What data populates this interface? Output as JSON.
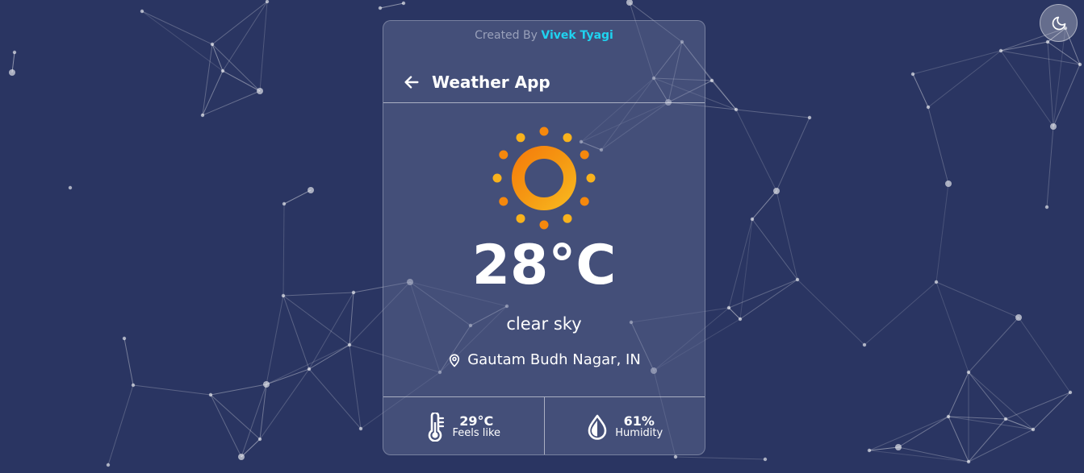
{
  "credit": {
    "prefix": "Created By",
    "author": "Vivek Tyagi"
  },
  "header": {
    "title": "Weather App"
  },
  "weather": {
    "temperature": "28°C",
    "description": "clear sky",
    "location": "Gautam Budh Nagar, IN"
  },
  "stats": {
    "feels_like": {
      "value": "29°C",
      "label": "Feels like"
    },
    "humidity": {
      "value": "61%",
      "label": "Humidity"
    }
  },
  "colors": {
    "background": "#2a3562",
    "accent": "#1fd3f0",
    "sun_orange": "#f5880d",
    "sun_yellow": "#f8b21d"
  },
  "icons": {
    "theme_toggle": "moon-icon",
    "back": "arrow-left-icon",
    "weather": "sun-icon",
    "location": "map-pin-icon",
    "feels_like": "thermometer-icon",
    "humidity": "droplet-icon"
  }
}
